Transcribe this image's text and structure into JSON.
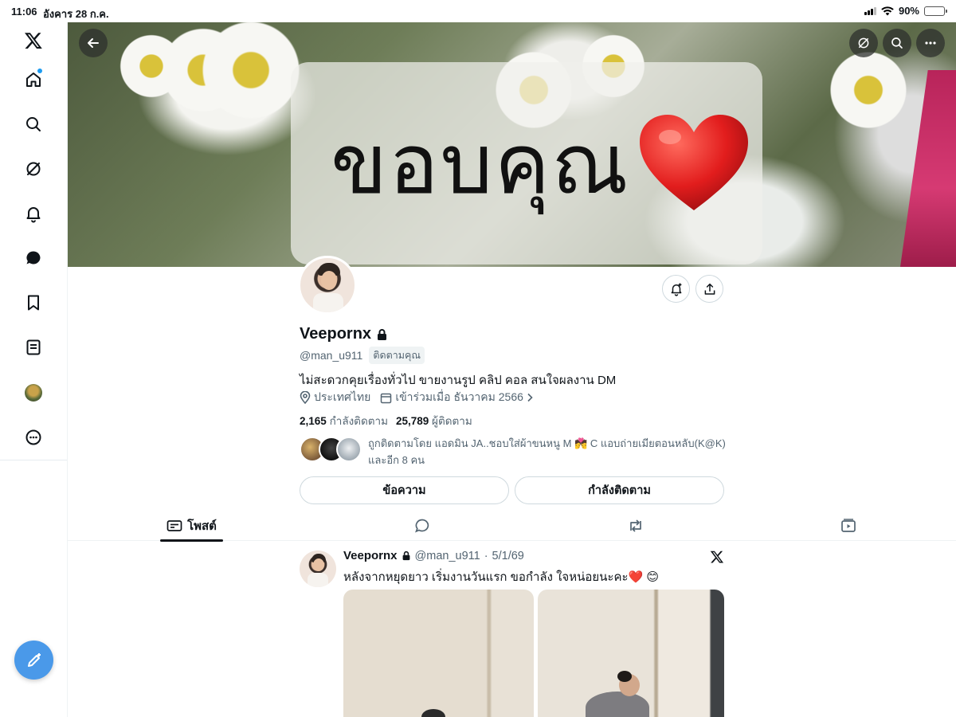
{
  "status_bar": {
    "time": "11:06",
    "date": "อังคาร 28 ก.ค.",
    "battery": "90%"
  },
  "nav": {
    "items": [
      "x-logo",
      "home",
      "search",
      "grok",
      "notifications",
      "messages",
      "bookmarks",
      "lists",
      "profile",
      "more"
    ],
    "has_home_notification": true
  },
  "banner": {
    "caption": "ขอบคุณ",
    "accent_color": "#c0265f"
  },
  "profile": {
    "name": "Veepornx",
    "handle": "@man_u911",
    "follows_you": "ติดตามคุณ",
    "bio": "ไม่สะดวกคุยเรื่องทั่วไป ขายงานรูป คลิป คอล สนใจผลงาน DM",
    "location": "ประเทศไทย",
    "joined": "เข้าร่วมเมื่อ ธันวาคม 2566",
    "following_count": "2,165",
    "following_label": "กำลังติดตาม",
    "followers_count": "25,789",
    "followers_label": "ผู้ติดตาม",
    "followed_by_line1": "ถูกติดตามโดย แอดมิน JA..ชอบใส่ผ้าขนหนู M 💏 C แอบถ่ายเมียตอนหลับ(K@K)",
    "followed_by_line2": "และอีก 8 คน",
    "message_button": "ข้อความ",
    "following_button": "กำลังติดตาม"
  },
  "tabs": [
    {
      "label": "โพสต์",
      "icon": "posts-icon",
      "active": true
    },
    {
      "label": "",
      "icon": "replies-icon",
      "active": false
    },
    {
      "label": "",
      "icon": "reposts-icon",
      "active": false
    },
    {
      "label": "",
      "icon": "media-icon",
      "active": false
    }
  ],
  "post": {
    "name": "Veepornx",
    "handle": "@man_u911",
    "separator": "·",
    "date": "5/1/69",
    "text": "หลังจากหยุดยาว เริ่มงานวันแรก ขอกำลัง ใจหน่อยนะคะ❤️ 😊"
  },
  "colors": {
    "accent": "#1d9bf0",
    "compose": "#4a99e9",
    "text": "#0f1419",
    "muted": "#536471"
  }
}
